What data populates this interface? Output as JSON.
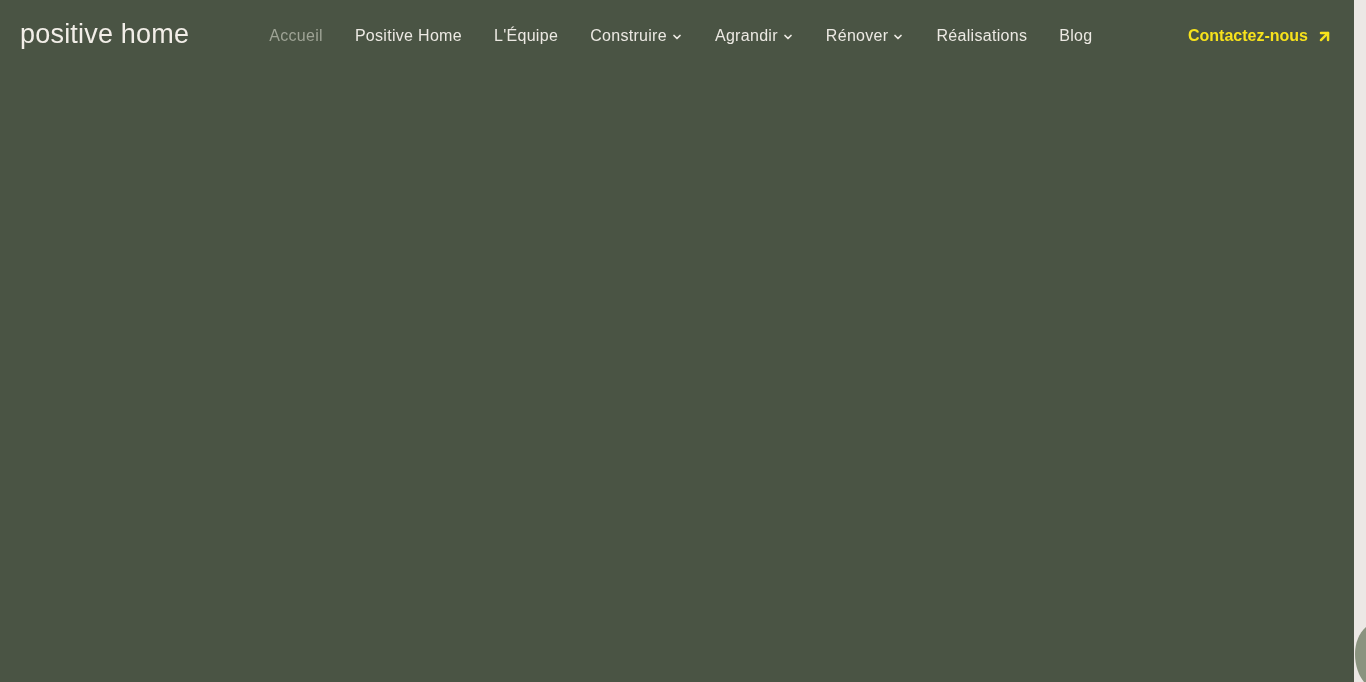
{
  "header": {
    "logo": "positive home",
    "nav": [
      {
        "label": "Accueil",
        "selected": true,
        "has_menu": false
      },
      {
        "label": "Positive Home",
        "selected": false,
        "has_menu": false
      },
      {
        "label": "L'Équipe",
        "selected": false,
        "has_menu": false
      },
      {
        "label": "Construire",
        "selected": false,
        "has_menu": true
      },
      {
        "label": "Agrandir",
        "selected": false,
        "has_menu": true
      },
      {
        "label": "Rénover",
        "selected": false,
        "has_menu": true
      },
      {
        "label": "Réalisations",
        "selected": false,
        "has_menu": false
      },
      {
        "label": "Blog",
        "selected": false,
        "has_menu": false
      }
    ],
    "cta": {
      "label": "Contactez-nous"
    }
  }
}
